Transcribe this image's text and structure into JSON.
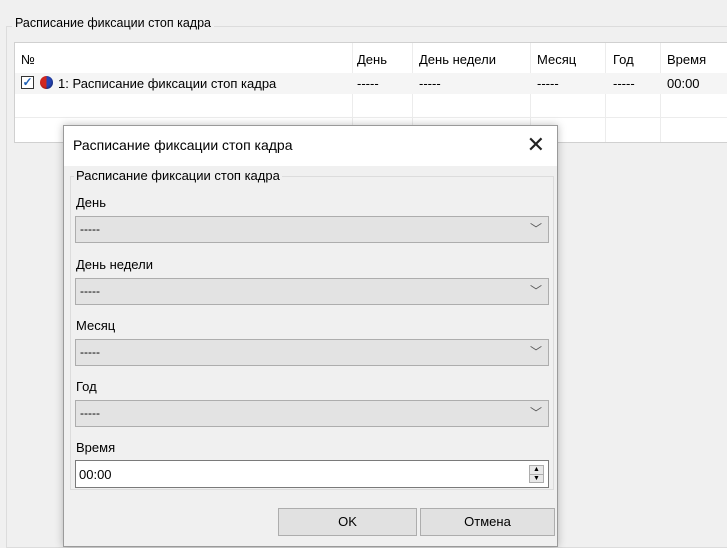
{
  "group": {
    "title": "Расписание фиксации стоп кадра"
  },
  "table": {
    "columns": [
      "№",
      "День",
      "День недели",
      "Месяц",
      "Год",
      "Время"
    ],
    "rows": [
      {
        "checked": true,
        "name": "1: Расписание фиксации стоп кадра",
        "day": "-----",
        "weekday": "-----",
        "month": "-----",
        "year": "-----",
        "time": "00:00"
      }
    ]
  },
  "dialog": {
    "title": "Расписание фиксации стоп кадра",
    "group_title": "Расписание фиксации стоп кадра",
    "fields": {
      "day": {
        "label": "День",
        "value": "-----"
      },
      "weekday": {
        "label": "День недели",
        "value": "-----"
      },
      "month": {
        "label": "Месяц",
        "value": "-----"
      },
      "year": {
        "label": "Год",
        "value": "-----"
      },
      "time": {
        "label": "Время",
        "value": "00:00"
      }
    },
    "ok_label": "OK",
    "cancel_label": "Отмена"
  },
  "icons": {
    "check": "checkmark-icon",
    "globe": "globe-icon",
    "close": "close-icon",
    "dropdown": "chevron-down-icon",
    "spin": "spin-arrows-icon"
  }
}
